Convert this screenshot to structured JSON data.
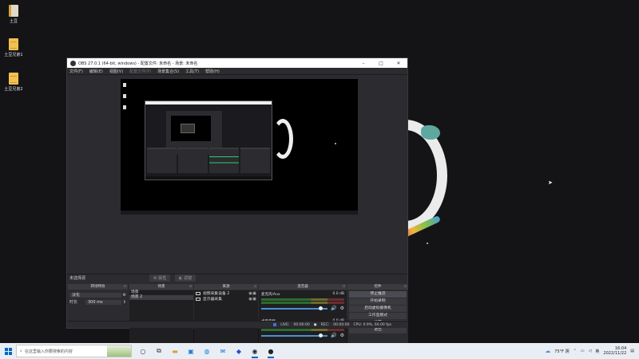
{
  "desktop": {
    "icons": [
      {
        "label": "土豆",
        "type": "app"
      },
      {
        "label": "土豆兄弟1",
        "type": "doc"
      },
      {
        "label": "土豆兄弟2",
        "type": "doc"
      }
    ]
  },
  "obs": {
    "title": "OBS 27.0.1 (64-bit, windows) - 配置文件: 未命名 - 场景: 未命名",
    "window_controls": {
      "minimize": "–",
      "maximize": "□",
      "close": "✕"
    },
    "menu": [
      "文件(F)",
      "编辑(E)",
      "视图(V)",
      "配置文件(P)",
      "场景集合(S)",
      "工具(T)",
      "帮助(H)"
    ],
    "menu_disabled_index": 3,
    "scene_bar": {
      "no_source": "未选择源",
      "properties": "属性",
      "filters": "滤镜"
    },
    "docks": {
      "transitions": {
        "header": "转场特效",
        "type_value": "淡化",
        "duration_label": "时长",
        "duration_value": "300 ms"
      },
      "scenes": {
        "header": "场景",
        "items": [
          "场景",
          "场景 2"
        ],
        "selected": 1
      },
      "sources": {
        "header": "来源",
        "items": [
          "视频采集设备 2",
          "显示器采集"
        ]
      },
      "mixer": {
        "header": "混音器",
        "channels": [
          {
            "name": "麦克风/Aux",
            "db": "0.0 dB"
          },
          {
            "name": "桌面音频",
            "db": "0.0 dB"
          }
        ]
      },
      "controls": {
        "header": "控件",
        "buttons": [
          "停止推流",
          "开始录制",
          "启动虚拟摄像机",
          "工作室模式",
          "设置",
          "退出"
        ]
      }
    },
    "status": {
      "live_label": "LIVE:",
      "live_time": "00:00:00",
      "rec_label": "REC:",
      "rec_time": "00:00:00",
      "cpu": "CPU: 0.9%, 60.00 fps"
    }
  },
  "taskbar": {
    "search_placeholder": "在这里输入你要搜索的内容",
    "weather": "75°F 阴",
    "ime": "英",
    "time": "16:04",
    "date": "2022/11/22"
  },
  "colors": {
    "accent": "#0067c0",
    "obs_bg": "#2b2b30",
    "desktop_bg": "#141417"
  }
}
